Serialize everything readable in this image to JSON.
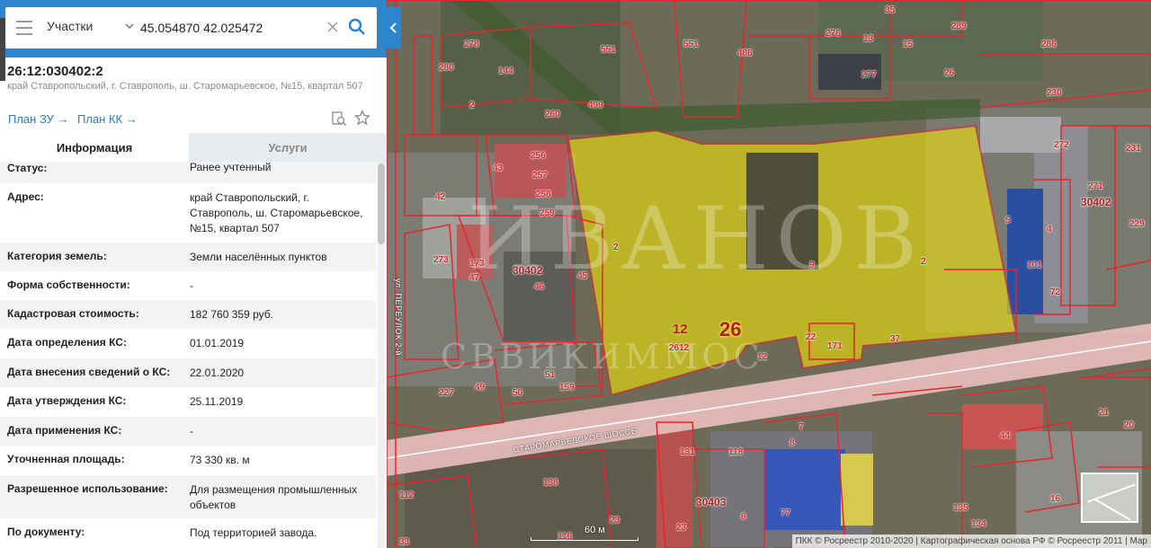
{
  "search": {
    "layer": "Участки",
    "query": "45.054870 42.025472"
  },
  "parcel": {
    "cadastral_number": "26:12:030402:2",
    "address_short": "край Ставропольский, г. Ставрополь, ш. Старомарьевское, №15, квартал 507"
  },
  "links": {
    "plan_zu": "План ЗУ →",
    "plan_kk": "План КК →"
  },
  "tabs": {
    "info": "Информация",
    "services": "Услуги"
  },
  "info_rows": [
    {
      "key": "Статус:",
      "value": "Ранее учтенный"
    },
    {
      "key": "Адрес:",
      "value": "край Ставропольский, г. Ставрополь, ш. Старомарьевское, №15, квартал 507"
    },
    {
      "key": "Категория земель:",
      "value": "Земли населённых пунктов"
    },
    {
      "key": "Форма собственности:",
      "value": "-"
    },
    {
      "key": "Кадастровая стоимость:",
      "value": "182 760 359 руб."
    },
    {
      "key": "Дата определения КС:",
      "value": "01.01.2019"
    },
    {
      "key": "Дата внесения сведений о КС:",
      "value": "22.01.2020"
    },
    {
      "key": "Дата утверждения КС:",
      "value": "25.11.2019"
    },
    {
      "key": "Дата применения КС:",
      "value": "-"
    },
    {
      "key": "Уточненная площадь:",
      "value": "73 330 кв. м"
    },
    {
      "key": "Разрешенное использование:",
      "value": "Для размещения промышленных объектов"
    },
    {
      "key": "По документу:",
      "value": "Под территорией завода."
    }
  ],
  "map": {
    "labels": {
      "l551a": "551",
      "l551b": "551",
      "l276": "276",
      "l13": "13",
      "l35": "35",
      "l15": "15",
      "l289": "289",
      "l286": "286",
      "l278": "278",
      "l280": "280",
      "l144": "144",
      "l486": "486",
      "l277": "277",
      "l26a": "26",
      "l230": "230",
      "l2a": "2",
      "l260": "260",
      "l499": "499",
      "l256": "256",
      "l257": "257",
      "l258": "258",
      "l259": "259",
      "l43": "43",
      "l42": "42",
      "l272": "272",
      "l271": "271",
      "l30402b": "30402",
      "l231": "231",
      "l229": "229",
      "l5": "5",
      "l4": "4",
      "l101": "101",
      "l72": "72",
      "l273": "273",
      "l173": "173",
      "l47": "47",
      "l30402a": "30402",
      "l46": "46",
      "l45": "45",
      "l2b": "2",
      "l2c": "2",
      "l9": "9",
      "l12": "12",
      "l2612": "2612",
      "l26big": "26",
      "l22": "22",
      "l171": "171",
      "l37": "37",
      "l12b": "12",
      "l227": "227",
      "l49": "49",
      "l50": "50",
      "l51": "51",
      "l159": "159",
      "l21": "21",
      "l20": "20",
      "l44": "44",
      "l131": "131",
      "l118": "118",
      "l138": "138",
      "l30403": "30403",
      "l23a": "23",
      "l23b": "23",
      "l77": "77",
      "l112": "112",
      "l33": "33",
      "l116": "116",
      "l7": "7",
      "l8": "8",
      "l16": "16",
      "l135": "135",
      "l134": "134",
      "l6": "6"
    },
    "road_label": "СТАРОМАРЬЕВСКОЕ ШОССЕ",
    "street_label": "ул. ПЕРЕУЛОК 2-й",
    "watermark": "ИВАНОВ",
    "watermark2": "СВВИКИММОС",
    "scale": "60 м",
    "attribution": "ПКК © Росреестр 2010-2020 | Картографическая основа РФ © Росреестр 2011 | Map"
  },
  "colors": {
    "accent": "#2d86cc",
    "parcel_fill": "#ffee00",
    "boundary": "#e5262d",
    "link": "#2d7dc4"
  }
}
